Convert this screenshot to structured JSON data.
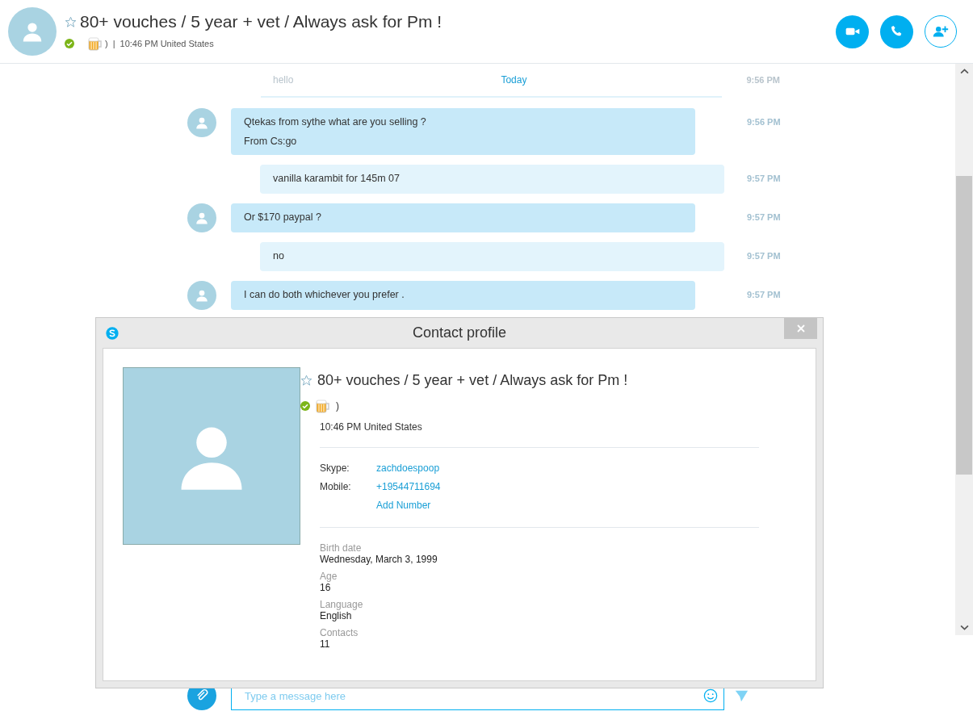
{
  "header": {
    "contact_name": "80+ vouches / 5 year + vet / Always ask for Pm !",
    "favorite": false,
    "online": true,
    "mood_suffix": ")",
    "separator": "|",
    "local_time": "10:46 PM United States"
  },
  "chat": {
    "faded_message": {
      "text": "hello",
      "time": "9:56 PM"
    },
    "date_divider": "Today",
    "messages": [
      {
        "kind": "incoming",
        "lines": [
          "Qtekas from sythe what are you selling ?",
          "From Cs:go"
        ],
        "time": "9:56 PM"
      },
      {
        "kind": "outgoing",
        "lines": [
          "vanilla karambit for 145m 07"
        ],
        "time": "9:57 PM"
      },
      {
        "kind": "incoming",
        "lines": [
          "Or $170 paypal ?"
        ],
        "time": "9:57 PM"
      },
      {
        "kind": "outgoing",
        "lines": [
          "no"
        ],
        "time": "9:57 PM"
      },
      {
        "kind": "incoming",
        "lines": [
          "I can do both whichever you prefer ."
        ],
        "time": "9:57 PM"
      }
    ]
  },
  "compose": {
    "placeholder": "Type a message here"
  },
  "profile_dialog": {
    "title": "Contact profile",
    "name": "80+ vouches / 5 year + vet / Always ask for Pm !",
    "favorite": false,
    "online": true,
    "mood_suffix": ")",
    "local_time": "10:46 PM United States",
    "contact_fields": [
      {
        "label": "Skype:",
        "value": "zachdoespoop"
      },
      {
        "label": "Mobile:",
        "value": "+19544711694"
      },
      {
        "value": "Add Number"
      }
    ],
    "details": [
      {
        "label": "Birth date",
        "value": "Wednesday, March 3, 1999"
      },
      {
        "label": "Age",
        "value": "16"
      },
      {
        "label": "Language",
        "value": "English"
      },
      {
        "label": "Contacts",
        "value": "11"
      }
    ]
  }
}
